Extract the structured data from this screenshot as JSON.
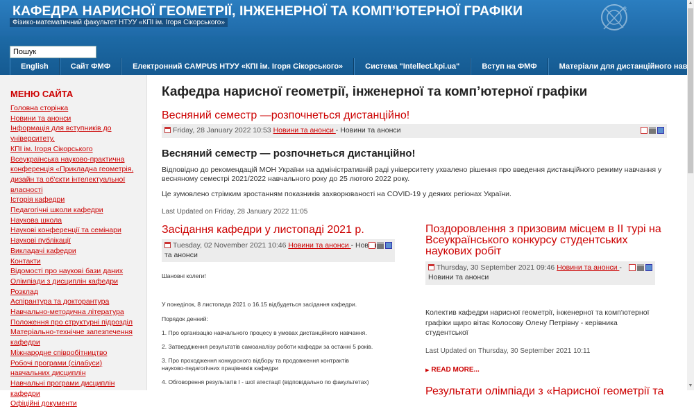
{
  "header": {
    "title": "КАФЕДРА НАРИСНОЇ ГЕОМЕТРІЇ, ІНЖЕНЕРНОЇ ТА КОМП’ЮТЕРНОЇ ГРАФІКИ",
    "subtitle": "Фізико-математичний факультет НТУУ «КПІ ім. Ігоря Сікорського»"
  },
  "search": {
    "value": "Пошук"
  },
  "topmenu": [
    "English",
    "Сайт ФМФ",
    "Електронний CAMPUS НТУУ «КПІ ім. Ігоря Сікорського»",
    "Система \"Intellect.kpi.ua\"",
    "Вступ на ФМФ",
    "Матеріали для дистанційного навчання"
  ],
  "sidebar": {
    "title": "МЕНЮ САЙТА",
    "items": [
      "Головна сторінка",
      "Новини та анонси",
      "Інформація для вступників до університету.",
      "КПІ ім. Ігоря Сікорського",
      "Всеукраїнська науково-практична конференція «Прикладна геометрія, дизайн та об'єкти інтелектуальної власності",
      "Історія кафедри",
      "Педагогічні школи кафедри",
      "Наукова школа",
      "Наукові конференції та семінари",
      "Наукові публікації",
      "Викладачі кафедри",
      "Контакти",
      "Відомості про наукові бази даних",
      "Олімпіади з дисциплін кафедри",
      "Розклад",
      "Аспірантура та докторантура",
      "Навчально-методична література",
      "Положення про структурні підрозділ",
      "Матеріально-технічне запезпечення кафедри",
      "Міжнародне співробітництво",
      "Робочі програми (сілабуси) навчальних дисциплін",
      "Навчальні програми дисциплін кафедри",
      "Офіційні документи"
    ]
  },
  "main": {
    "page_title": "Кафедра нарисної геометрії, інженерної та комп’ютерної графіки",
    "article1": {
      "title": "Весняний семестр —розпочнеться дистанційно!",
      "date": "Friday, 28 January 2022 10:53",
      "category": "Новини та анонси ",
      "category_plain": " - Новини та анонси",
      "heading": "Весняний семестр — розпочнеться дистанційно!",
      "para1": "Відповідно до рекомендацій МОН України на адміністративній раді університету ухвалено рішення про введення дистанційного режиму навчання у весняному семестрі 2021/2022 навчального року до 25 лютого 2022 року.",
      "para2": "Це зумовлено стрімким зростанням показників захворюваності на COVID-19 у деяких регіонах України.",
      "updated": "Last Updated on Friday, 28 January 2022 11:05"
    },
    "article2": {
      "title": "Засідання кафедри у листопаді 2021 р.",
      "date": "Tuesday, 02 November 2021 10:46",
      "category": "Новини та анонси ",
      "category_plain": "- Новини",
      "category_plain2": "та анонси",
      "greeting": "Шановні колеги!",
      "intro": "У понеділок, 8 листопада 2021 о 16.15 відбудеться засідання кафедри.",
      "agenda_label": "Порядок денний:",
      "agenda": [
        "1.  Про організацію навчального процесу в умовах дистанційного навчання.",
        "2.  Затвердження результатів самоаналізу роботи кафедри за останні 5 років.",
        "3.  Про проходження конкурсного відбору та продовження контрактів науково-педагогічних працівників кафедри",
        "4.  Обговорення результатів І - шої атестації (відповідально по факультетах)"
      ]
    },
    "article3": {
      "title": "Поздоровлення з призовим місцем в ІІ турі на Всеукраїнського конкурсу студентських наукових робіт",
      "date": "Thursday, 30 September 2021 09:46",
      "category": "Новини та анонси ",
      "category_plain": "-",
      "category_plain2": "Новини та анонси",
      "body": " Колектив кафедри нарисної геометрії, інженерної та комп'ютерної графіки щиро вітає Колосову Олену Петрівну - керівника студентської",
      "updated": "Last Updated on Thursday, 30 September 2021 10:11",
      "read_more": "READ MORE..."
    },
    "article4": {
      "title": "Результати олімпіади з «Нарисної геометрії та"
    }
  }
}
